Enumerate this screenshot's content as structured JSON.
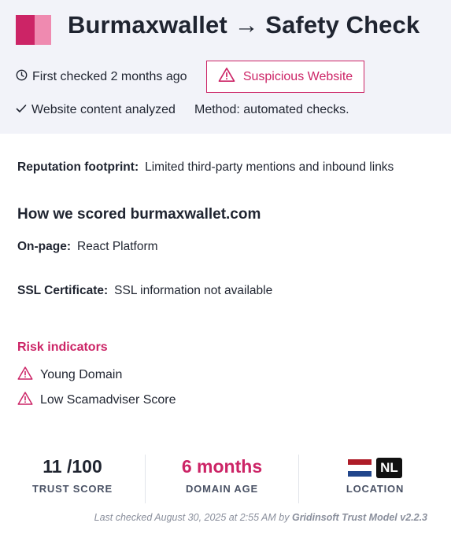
{
  "header": {
    "title": "Burmaxwallet → Safety Check",
    "first_checked": "First checked 2 months ago",
    "badge": "Suspicious Website",
    "analyzed": "Website content analyzed",
    "method": "Method: automated checks."
  },
  "details": {
    "reputation_label": "Reputation footprint:",
    "reputation_value": "Limited third-party mentions and inbound links",
    "scored_heading": "How we scored burmaxwallet.com",
    "onpage_label": "On-page:",
    "onpage_value": "React Platform",
    "ssl_label": "SSL Certificate:",
    "ssl_value": "SSL information not available"
  },
  "risk": {
    "title": "Risk indicators",
    "items": [
      "Young Domain",
      "Low Scamadviser Score"
    ]
  },
  "stats": {
    "trust_value": "11 /100",
    "trust_label": "TRUST SCORE",
    "age_value": "6 months",
    "age_label": "DOMAIN AGE",
    "location_code": "NL",
    "location_label": "LOCATION"
  },
  "footer": {
    "prefix": "Last checked August 30, 2025 at 2:55 AM by",
    "model": "Gridinsoft Trust Model v2.2.3"
  },
  "colors": {
    "accent": "#cc2466",
    "accent_light": "#ef8ab0",
    "header_bg": "#f2f3f9"
  },
  "icons": [
    "clock-icon",
    "warning-icon",
    "check-icon",
    "netherlands-flag-icon"
  ]
}
